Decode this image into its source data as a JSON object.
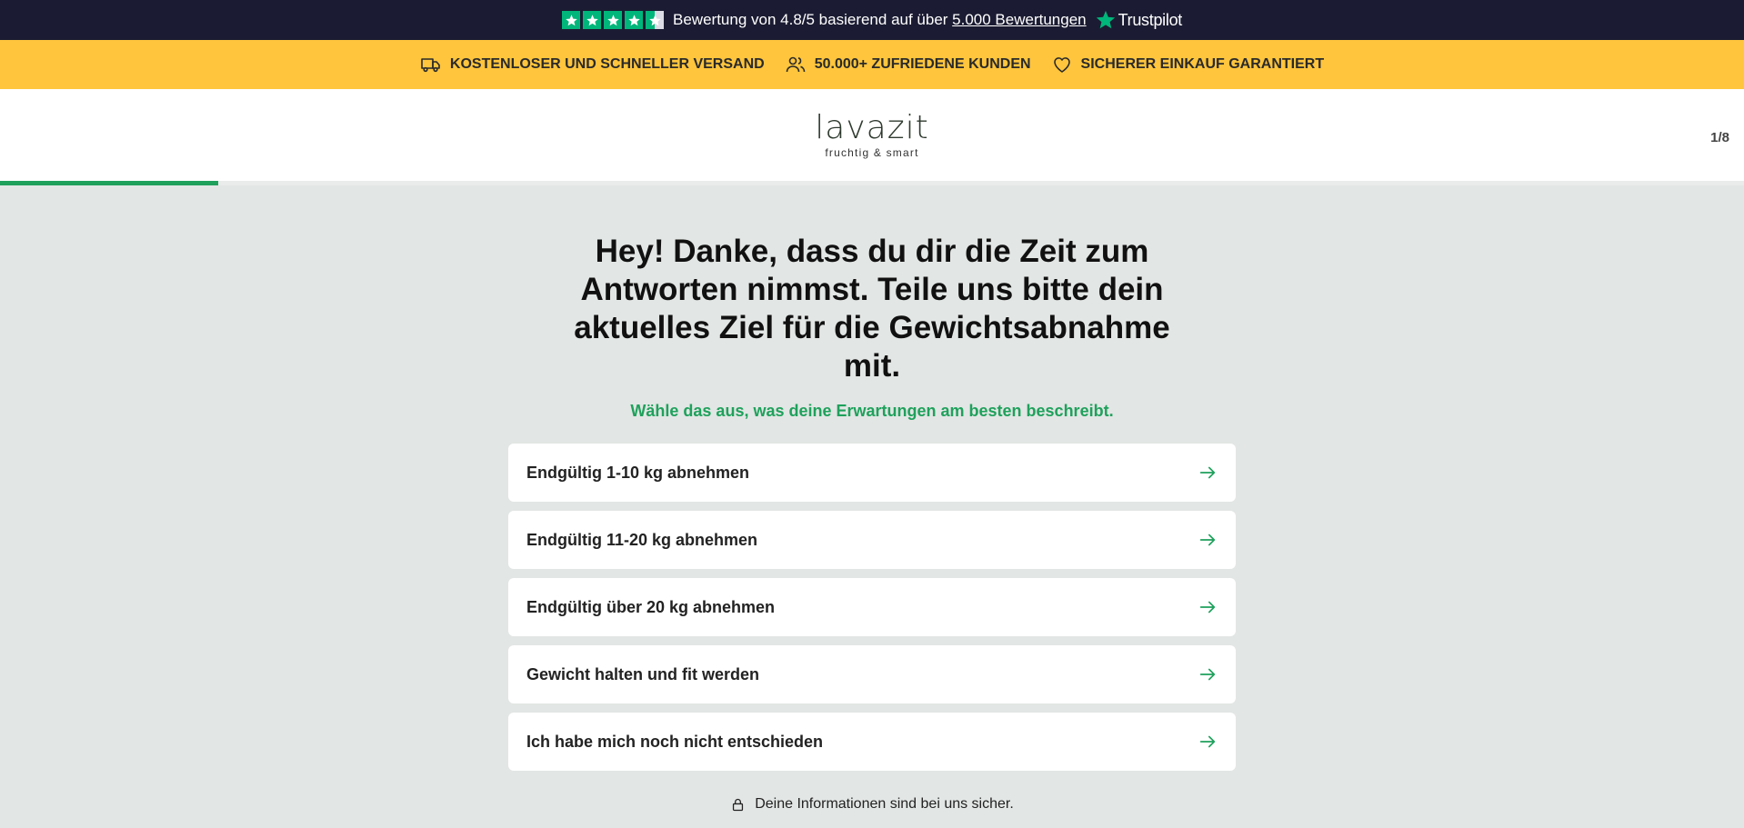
{
  "topbar": {
    "rating_text": "Bewertung von 4.8/5 basierend auf über ",
    "reviews_link": "5.000 Bewertungen",
    "brand": "Trustpilot",
    "stars": 4.5,
    "accent": "#00b67a"
  },
  "promo": {
    "items": [
      {
        "icon": "truck-icon",
        "label": "KOSTENLOSER UND SCHNELLER VERSAND"
      },
      {
        "icon": "users-icon",
        "label": "50.000+ ZUFRIEDENE KUNDEN"
      },
      {
        "icon": "heart-icon",
        "label": "SICHERER EINKAUF GARANTIERT"
      }
    ],
    "background": "#fec53d"
  },
  "header": {
    "logo_text": "lavazit",
    "logo_tagline": "fruchtig & smart",
    "step": "1/8"
  },
  "progress": {
    "value": 0.125,
    "color": "#1fa15c"
  },
  "main": {
    "headline": "Hey! Danke, dass du dir die Zeit zum Antworten nimmst. Teile uns bitte dein aktuelles Ziel für die Gewichtsabnahme mit.",
    "subline": "Wähle das aus, was deine Erwartungen am besten beschreibt.",
    "options": [
      "Endgültig 1-10 kg abnehmen",
      "Endgültig 11-20 kg abnehmen",
      "Endgültig über 20 kg abnehmen",
      "Gewicht halten und fit werden",
      "Ich habe mich noch nicht entschieden"
    ],
    "secure_note": "Deine Informationen sind bei uns sicher."
  }
}
